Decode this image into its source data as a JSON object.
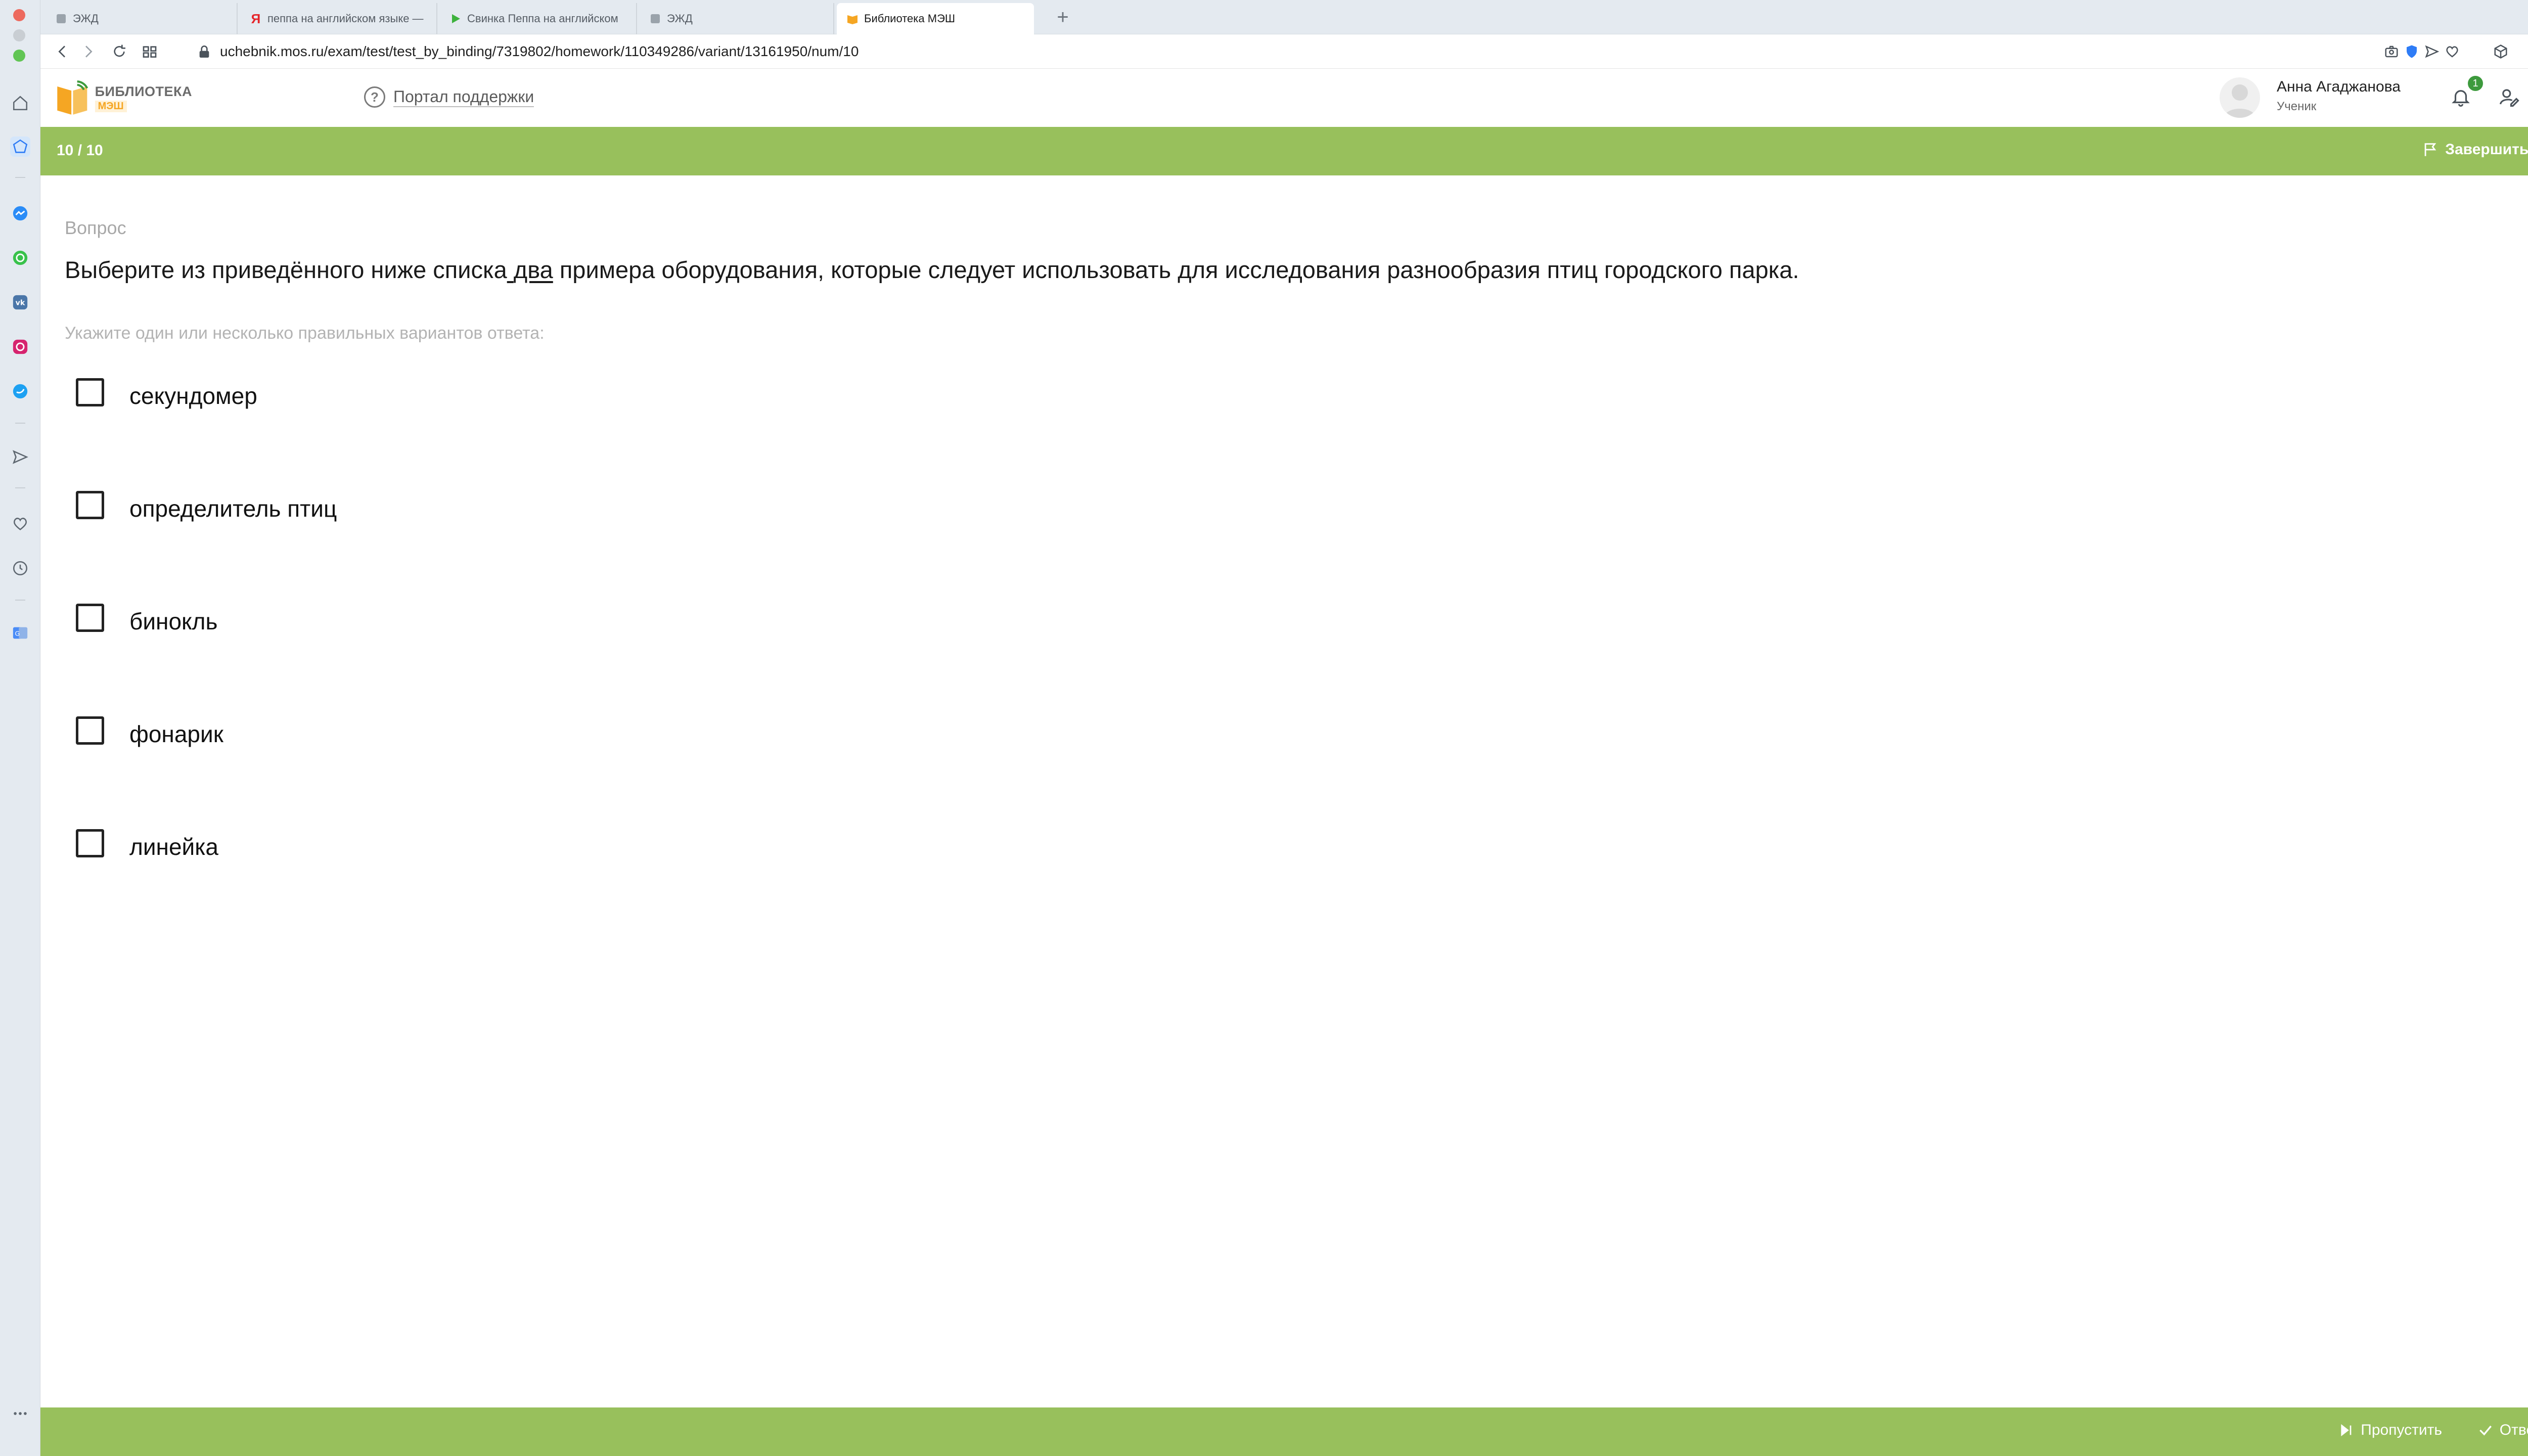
{
  "browser": {
    "tabs": [
      {
        "title": "ЭЖД",
        "favicon": "ezhd-icon"
      },
      {
        "title": "пеппа на английском языке —",
        "favicon": "yandex-icon"
      },
      {
        "title": "Свинка Пеппа на английском",
        "favicon": "play-icon"
      },
      {
        "title": "ЭЖД",
        "favicon": "ezhd-icon"
      },
      {
        "title": "Библиотека МЭШ",
        "favicon": "mesh-book-icon"
      }
    ],
    "url": "uchebnik.mos.ru/exam/test/test_by_binding/7319802/homework/110349286/variant/13161950/num/10"
  },
  "header": {
    "logo_title": "БИБЛИОТЕКА",
    "logo_sub": "МЭШ",
    "support_label": "Портал поддержки",
    "user_name": "Анна Агаджанова",
    "user_role": "Ученик",
    "notifications_count": "1"
  },
  "topbar": {
    "progress": "10 / 10",
    "finish_label": "Завершить тест"
  },
  "question": {
    "label": "Вопрос",
    "text_before": "Выберите из приведённого ниже списка",
    "text_emphasis": "два",
    "text_after": " примера оборудования, которые следует использовать для исследования разнообразия птиц городского парка.",
    "instruction": "Укажите один или несколько правильных вариантов ответа:",
    "options": [
      {
        "label": "секундомер",
        "checked": false
      },
      {
        "label": "определитель птиц",
        "checked": false
      },
      {
        "label": "бинокль",
        "checked": false
      },
      {
        "label": "фонарик",
        "checked": false
      },
      {
        "label": "линейка",
        "checked": false
      }
    ]
  },
  "bottombar": {
    "skip_label": "Пропустить",
    "answer_label": "Ответить"
  },
  "colors": {
    "accent_green": "#98c05c",
    "logo_orange": "#f5a623"
  }
}
